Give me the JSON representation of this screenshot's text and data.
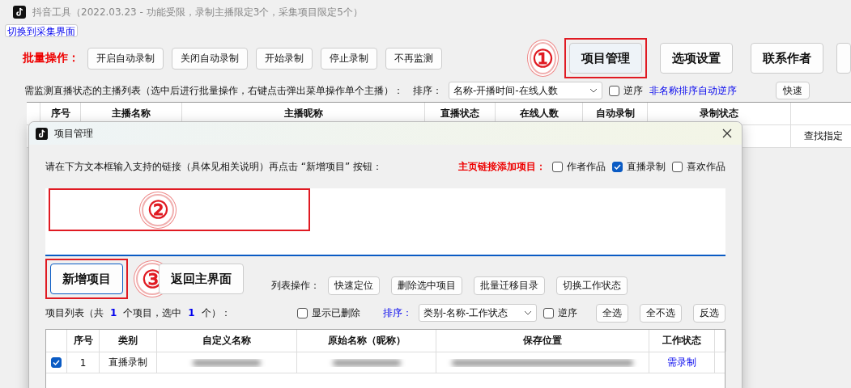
{
  "window": {
    "title": "抖音工具（2022.03.23 - 功能受限，录制主播限定3个，采集项目限定5个）"
  },
  "switch_link": "切换到采集界面",
  "batch": {
    "label": "批量操作：",
    "buttons": [
      "开启自动录制",
      "关闭自动录制",
      "开始录制",
      "停止录制",
      "不再监测"
    ]
  },
  "main_buttons": [
    {
      "label": "项目管理",
      "highlighted": true,
      "annotation": "①"
    },
    {
      "label": "选项设置",
      "highlighted": false
    },
    {
      "label": "联系作者",
      "highlighted": false
    }
  ],
  "list_bar": {
    "label": "需监测直播状态的主播列表（选中后进行批量操作，右键点击弹出菜单操作单个主播）：",
    "sort_label": "排序：",
    "sort_value": "名称-开播时间-在线人数",
    "reverse": {
      "label": "逆序",
      "checked": false
    },
    "link": "非名称排序自动逆序",
    "cut_button": "快速"
  },
  "table": {
    "columns": [
      "序号",
      "主播名称",
      "主播昵称",
      "直播状态",
      "在线人数",
      "自动录制",
      "录制状态"
    ],
    "visible_cell": "查找指定"
  },
  "dialog": {
    "title": "项目管理",
    "instruction": "请在下方文本框输入支持的链接（具体见相关说明）再点击 “新增项目” 按钮：",
    "homepage_label": "主页链接添加项目：",
    "homepage_options": [
      {
        "label": "作者作品",
        "checked": false
      },
      {
        "label": "直播录制",
        "checked": true
      },
      {
        "label": "喜欢作品",
        "checked": false
      }
    ],
    "input_annotation": "②",
    "add_button": {
      "label": "新增项目",
      "annotation": "③"
    },
    "back_button": "返回主界面",
    "list_ops_label": "列表操作：",
    "list_ops": [
      "快速定位",
      "删除选中项目",
      "批量迁移目录",
      "切换工作状态"
    ],
    "summary": {
      "prefix": "项目列表（共",
      "total": "1",
      "middle": "个项目，选中",
      "selected": "1",
      "suffix": "个）："
    },
    "show_deleted": {
      "label": "显示已删除",
      "checked": false
    },
    "sort_label": "排序：",
    "sort_value": "类别-名称-工作状态",
    "reverse": {
      "label": "逆序",
      "checked": false
    },
    "select_buttons": [
      "全选",
      "全不选",
      "反选"
    ],
    "table": {
      "columns": [
        "序号",
        "类别",
        "自定义名称",
        "原始名称（昵称）",
        "保存位置",
        "工作状态"
      ],
      "rows": [
        {
          "checked": true,
          "index": "1",
          "category": "直播录制",
          "status": "需录制"
        }
      ]
    }
  }
}
